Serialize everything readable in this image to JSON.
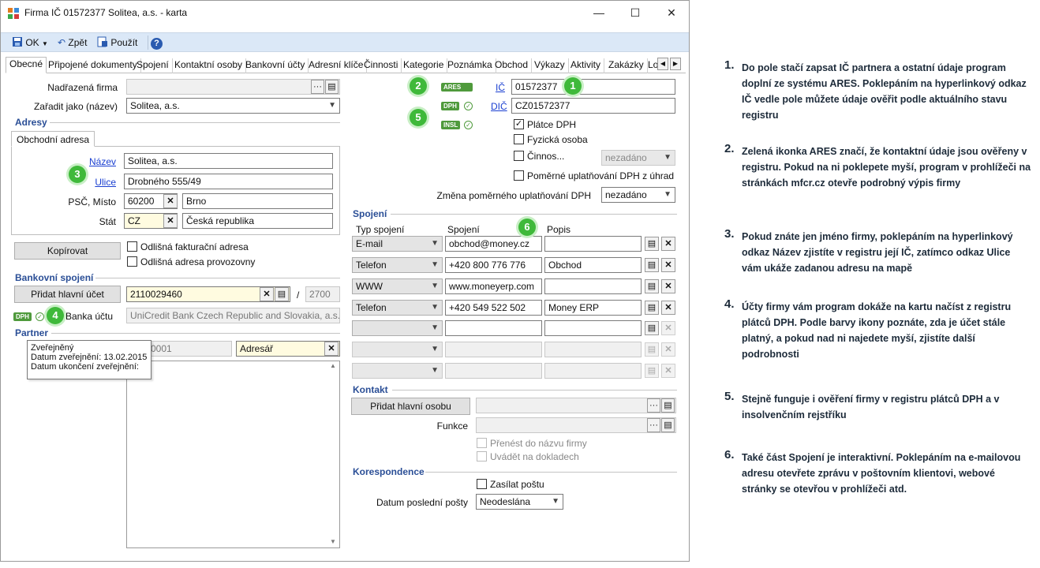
{
  "window": {
    "title": "Firma IČ 01572377 Solitea, a.s. - karta",
    "controls": [
      "—",
      "☐",
      "✕"
    ]
  },
  "toolbar": {
    "ok": "OK",
    "back": "Zpět",
    "apply": "Použít"
  },
  "tabs": [
    "Obecné",
    "Připojené dokumenty",
    "Spojení",
    "Kontaktní osoby",
    "Bankovní účty",
    "Adresní klíče",
    "Činnosti",
    "Kategorie",
    "Poznámka",
    "Obchod",
    "Výkazy",
    "Aktivity",
    "Zakázky",
    "Lo"
  ],
  "general": {
    "parent_label": "Nadřazená firma",
    "classify_label": "Zařadit jako (název)",
    "classify_value": "Solitea, a.s."
  },
  "addresses": {
    "section": "Adresy",
    "tab": "Obchodní adresa",
    "name_label": "Název",
    "name_value": "Solitea, a.s.",
    "street_label": "Ulice",
    "street_value": "Drobného 555/49",
    "zip_label": "PSČ, Místo",
    "zip_value": "60200",
    "city_value": "Brno",
    "country_label": "Stát",
    "country_code": "CZ",
    "country_name": "Česká republika"
  },
  "copy_button": "Kopírovat",
  "checks_address": [
    {
      "label": "Odlišná fakturační adresa",
      "checked": false
    },
    {
      "label": "Odlišná adresa provozovny",
      "checked": false
    }
  ],
  "bank": {
    "section": "Bankovní spojení",
    "add_button": "Přidat hlavní účet",
    "account": "2110029460",
    "slash": "/",
    "code": "2700",
    "bank_label": "Banka účtu",
    "bank_name": "UniCredit Bank Czech Republic and Slovakia, a.s."
  },
  "partner": {
    "section": "Partner",
    "partner_code": "0001",
    "group_value": "Adresář"
  },
  "tooltip": {
    "line1": "Zveřejněný",
    "line2": "Datum zveřejnění: 13.02.2015",
    "line3": "Datum ukončení zveřejnění:"
  },
  "ids": {
    "ic_label": "IČ",
    "ic_value": "01572377",
    "dic_label": "DIČ",
    "dic_value": "CZ01572377",
    "ares_badge": "ARES",
    "dph_badge": "DPH",
    "insl_badge": "INSL",
    "vat_payer": "Plátce DPH",
    "natural_person": "Fyzická osoba",
    "activity": "Činnos...",
    "activity_value": "nezadáno",
    "proportional": "Poměrné uplatňování DPH z úhrad",
    "proportional_change_label": "Změna poměrného uplatňování DPH",
    "proportional_change_value": "nezadáno"
  },
  "contacts": {
    "section": "Spojení",
    "col_type": "Typ spojení",
    "col_contact": "Spojení",
    "col_desc": "Popis",
    "rows": [
      {
        "type": "E-mail",
        "value": "obchod@money.cz",
        "desc": ""
      },
      {
        "type": "Telefon",
        "value": "+420 800 776 776",
        "desc": "Obchod"
      },
      {
        "type": "WWW",
        "value": "www.moneyerp.com",
        "desc": ""
      },
      {
        "type": "Telefon",
        "value": "+420 549 522 502",
        "desc": "Money ERP"
      },
      {
        "type": "",
        "value": "",
        "desc": ""
      },
      {
        "type": "",
        "value": "",
        "desc": ""
      },
      {
        "type": "",
        "value": "",
        "desc": ""
      }
    ]
  },
  "contact_person": {
    "section": "Kontakt",
    "add_button": "Přidat hlavní osobu",
    "function_label": "Funkce",
    "transfer": "Přenést do názvu firmy",
    "show_docs": "Uvádět na dokladech"
  },
  "correspondence": {
    "section": "Korespondence",
    "send_mail": "Zasílat poštu",
    "last_mail_label": "Datum poslední pošty",
    "last_mail_value": "Neodeslána"
  },
  "markers": [
    "1",
    "2",
    "3",
    "4",
    "5",
    "6"
  ],
  "notes": [
    {
      "n": "1.",
      "text": "Do pole stačí zapsat IČ partnera a ostatní údaje program doplní ze systému ARES. Poklepáním na hyperlinkový odkaz IČ vedle pole můžete údaje ověřit podle aktuálního stavu registru"
    },
    {
      "n": "2.",
      "text": "Zelená ikonka ARES značí, že kontaktní údaje jsou ověřeny v registru. Pokud na ni poklepete myší, program v prohlížeči na stránkách mfcr.cz otevře podrobný výpis firmy"
    },
    {
      "n": "3.",
      "text": "Pokud znáte jen jméno firmy, poklepáním na hyperlinkový odkaz Název zjistíte v registru její IČ, zatímco odkaz Ulice vám ukáže zadanou adresu na mapě"
    },
    {
      "n": "4.",
      "text": "Účty firmy vám program dokáže na kartu načíst z registru plátců DPH. Podle barvy ikony poznáte, zda je účet stále platný, a pokud nad ni najedete myší, zjistíte další podrobnosti"
    },
    {
      "n": "5.",
      "text": "Stejně funguje i ověření firmy v registru plátců DPH a v insolvenčním rejstříku"
    },
    {
      "n": "6.",
      "text": "Také část Spojení je interaktivní. Poklepáním na e-mailovou adresu otevřete zprávu v poštovním klientovi, webové stránky se otevřou v prohlížeči atd."
    }
  ],
  "colors": {
    "accent": "#2a4e96",
    "link": "#1a3fd1",
    "badge_green": "#3fb93a",
    "toolbar_bg": "#dbe8f7",
    "field_yellow": "#fffbe0"
  }
}
